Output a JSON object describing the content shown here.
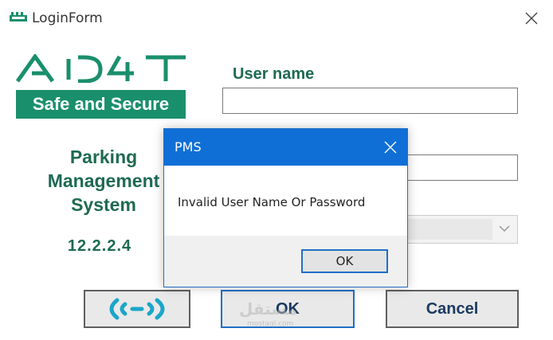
{
  "window": {
    "title": "LoginForm"
  },
  "branding": {
    "logo_text": "AD4T",
    "tagline": "Safe and Secure",
    "product_lines": [
      "Parking",
      "Management",
      "System"
    ],
    "version": "12.2.2.4"
  },
  "form": {
    "username_label": "User name",
    "username_value": "",
    "password_value": "",
    "select_value": ""
  },
  "buttons": {
    "ok_label": "OK",
    "cancel_label": "Cancel"
  },
  "dialog": {
    "title": "PMS",
    "message": "Invalid User Name Or Password",
    "ok_label": "OK"
  },
  "watermark": {
    "main": "مستقل",
    "sub": "mostaql.com"
  },
  "colors": {
    "brand_green": "#1a8f6b",
    "dialog_title_blue": "#0f6fd6",
    "focus_blue": "#1f6fc6"
  },
  "icons": {
    "app": "app-icon",
    "close": "close-icon",
    "rfid": "rfid-icon",
    "dropdown": "chevron-down-icon"
  }
}
